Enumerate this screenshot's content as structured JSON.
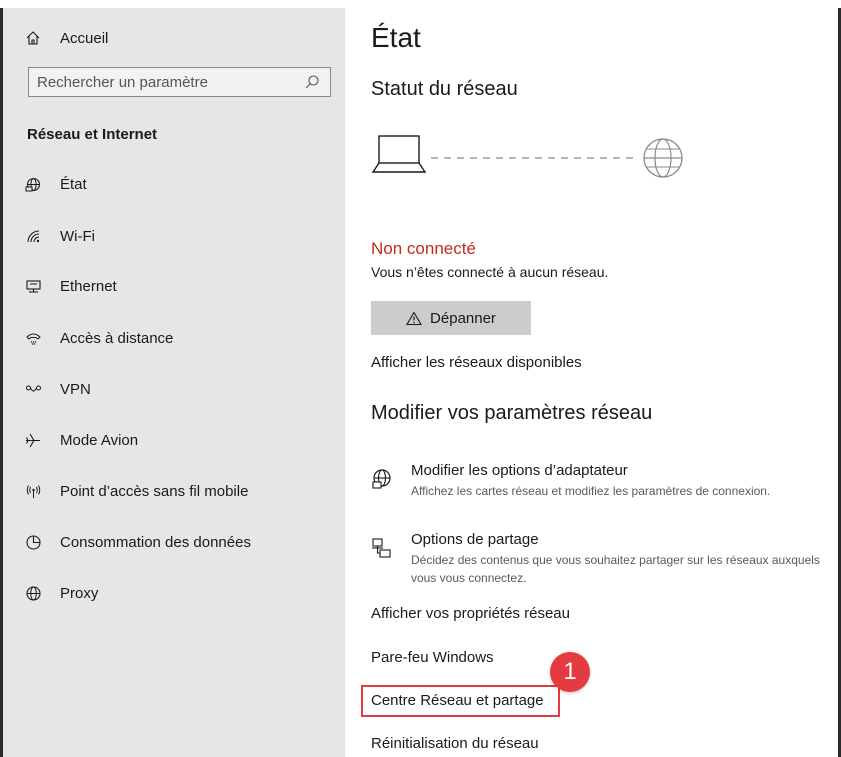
{
  "sidebar": {
    "home_label": "Accueil",
    "search_placeholder": "Rechercher un paramètre",
    "section_title": "Réseau et Internet",
    "items": [
      {
        "label": "État"
      },
      {
        "label": "Wi-Fi"
      },
      {
        "label": "Ethernet"
      },
      {
        "label": "Accès à distance"
      },
      {
        "label": "VPN"
      },
      {
        "label": "Mode Avion"
      },
      {
        "label": "Point d’accès sans fil mobile"
      },
      {
        "label": "Consommation des données"
      },
      {
        "label": "Proxy"
      }
    ]
  },
  "main": {
    "title": "État",
    "network_status_heading": "Statut du réseau",
    "status_text": "Non connecté",
    "status_subtext": "Vous n’êtes connecté à aucun réseau.",
    "troubleshoot_label": "Dépanner",
    "show_networks_link": "Afficher les réseaux disponibles",
    "modify_heading": "Modifier vos paramètres réseau",
    "adapter_options": {
      "title": "Modifier les options d’adaptateur",
      "desc": "Affichez les cartes réseau et modifiez les paramètres de connexion."
    },
    "sharing_options": {
      "title": "Options de partage",
      "desc": "Décidez des contenus que vous souhaitez partager sur les réseaux auxquels vous vous connectez."
    },
    "links": {
      "properties": "Afficher vos propriétés réseau",
      "firewall": "Pare-feu Windows",
      "network_center": "Centre Réseau et partage",
      "reset": "Réinitialisation du réseau"
    },
    "annotation_badge": "1"
  },
  "colors": {
    "sidebar_bg": "#e6e6e6",
    "status_red": "#c42b1c",
    "annotation_red": "#e53a3f",
    "button_bg": "#cccccc"
  }
}
